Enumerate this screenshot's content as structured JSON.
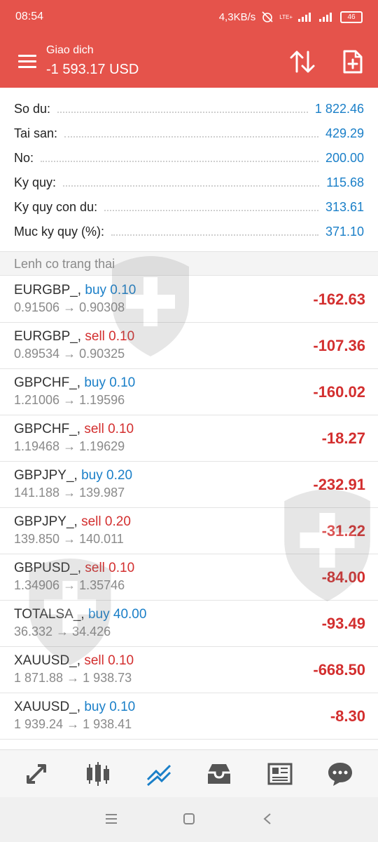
{
  "status": {
    "time": "08:54",
    "speed": "4,3KB/s",
    "lte": "LTE+",
    "battery": "46"
  },
  "header": {
    "title": "Giao dich",
    "balance": "-1 593.17 USD"
  },
  "summary": [
    {
      "label": "So du:",
      "value": "1 822.46"
    },
    {
      "label": "Tai san:",
      "value": "429.29"
    },
    {
      "label": "No:",
      "value": "200.00"
    },
    {
      "label": "Ky quy:",
      "value": "115.68"
    },
    {
      "label": "Ky quy con du:",
      "value": "313.61"
    },
    {
      "label": "Muc ky quy (%):",
      "value": "371.10"
    }
  ],
  "section_title": "Lenh co trang thai",
  "orders": [
    {
      "symbol": "EURGBP_,",
      "side": "buy",
      "volume": "0.10",
      "prices": "0.91506 → 0.90308",
      "profit": "-162.63"
    },
    {
      "symbol": "EURGBP_,",
      "side": "sell",
      "volume": "0.10",
      "prices": "0.89534 → 0.90325",
      "profit": "-107.36"
    },
    {
      "symbol": "GBPCHF_,",
      "side": "buy",
      "volume": "0.10",
      "prices": "1.21006 → 1.19596",
      "profit": "-160.02"
    },
    {
      "symbol": "GBPCHF_,",
      "side": "sell",
      "volume": "0.10",
      "prices": "1.19468 → 1.19629",
      "profit": "-18.27"
    },
    {
      "symbol": "GBPJPY_,",
      "side": "buy",
      "volume": "0.20",
      "prices": "141.188 → 139.987",
      "profit": "-232.91"
    },
    {
      "symbol": "GBPJPY_,",
      "side": "sell",
      "volume": "0.20",
      "prices": "139.850 → 140.011",
      "profit": "-31.22"
    },
    {
      "symbol": "GBPUSD_,",
      "side": "sell",
      "volume": "0.10",
      "prices": "1.34906 → 1.35746",
      "profit": "-84.00"
    },
    {
      "symbol": "TOTALSA_,",
      "side": "buy",
      "volume": "40.00",
      "prices": "36.332 → 34.426",
      "profit": "-93.49"
    },
    {
      "symbol": "XAUUSD_,",
      "side": "sell",
      "volume": "0.10",
      "prices": "1 871.88 → 1 938.73",
      "profit": "-668.50"
    },
    {
      "symbol": "XAUUSD_,",
      "side": "buy",
      "volume": "0.10",
      "prices": "1 939.24 → 1 938.41",
      "profit": "-8.30"
    }
  ],
  "bottom_nav": [
    {
      "icon": "quotes-icon"
    },
    {
      "icon": "chart-icon"
    },
    {
      "icon": "trade-icon",
      "active": true
    },
    {
      "icon": "history-icon"
    },
    {
      "icon": "news-icon"
    },
    {
      "icon": "chat-icon"
    }
  ],
  "colors": {
    "header": "#e5534b",
    "buy": "#1a7fc8",
    "sell": "#d32f2f",
    "active_nav": "#1a7fc8"
  }
}
